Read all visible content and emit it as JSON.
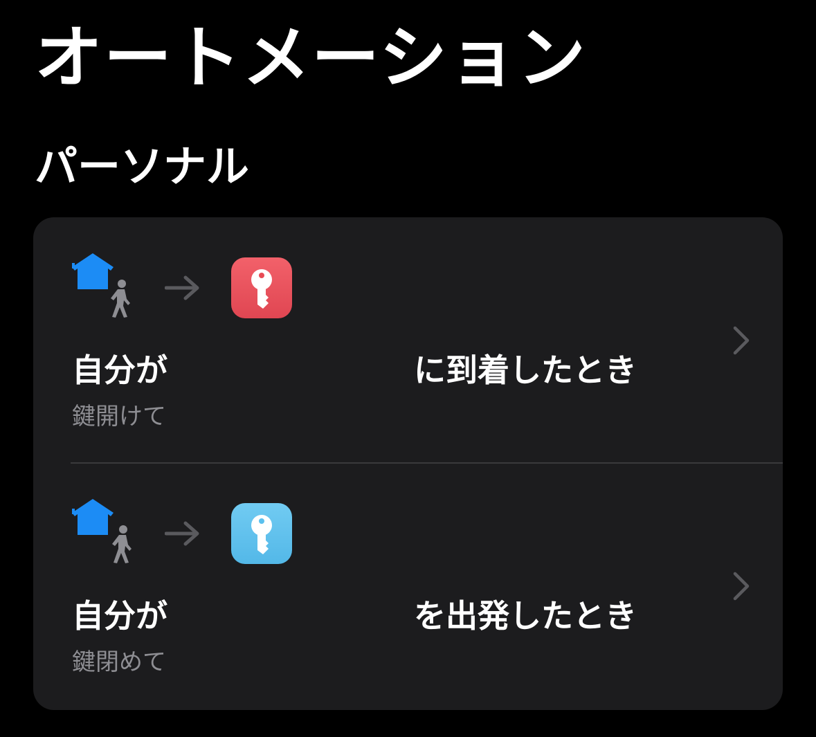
{
  "header": {
    "title": "オートメーション"
  },
  "section": {
    "title": "パーソナル"
  },
  "automations": [
    {
      "trigger_icon": "home-person-walking-icon",
      "arrow_icon": "arrow-right-icon",
      "action_icon": "key-icon",
      "action_color": "#e84b55",
      "subject": "自分が",
      "condition": "に到着したとき",
      "shortcut_name": "鍵開けて",
      "chevron_icon": "chevron-right-icon"
    },
    {
      "trigger_icon": "home-person-walking-icon",
      "arrow_icon": "arrow-right-icon",
      "action_icon": "key-icon",
      "action_color": "#5bc0ee",
      "subject": "自分が",
      "condition": "を出発したとき",
      "shortcut_name": "鍵閉めて",
      "chevron_icon": "chevron-right-icon"
    }
  ],
  "colors": {
    "background": "#000000",
    "card": "#1c1c1e",
    "home_icon": "#1c8cf5",
    "secondary_text": "#8e8e93"
  }
}
